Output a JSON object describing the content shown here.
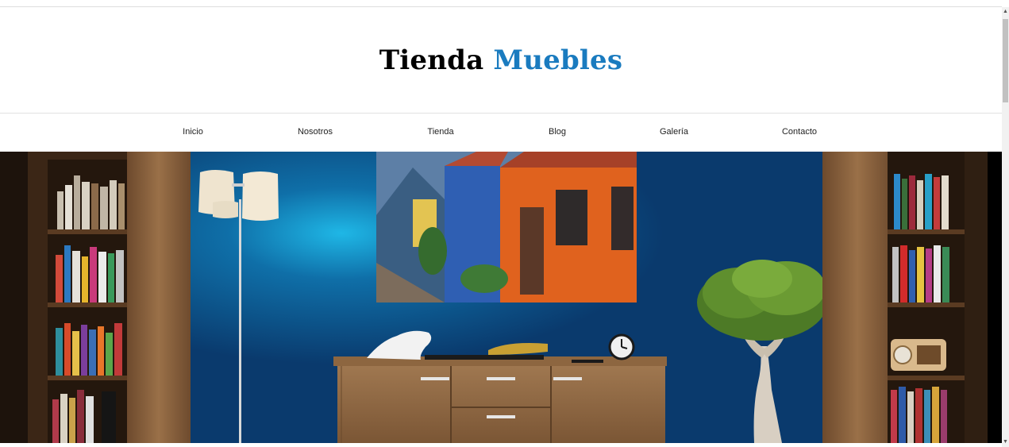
{
  "header": {
    "title_part1": "Tienda",
    "title_part2": "Muebles",
    "accent_color": "#1a7bbf"
  },
  "nav": {
    "items": [
      {
        "label": "Inicio"
      },
      {
        "label": "Nosotros"
      },
      {
        "label": "Tienda"
      },
      {
        "label": "Blog"
      },
      {
        "label": "Galería"
      },
      {
        "label": "Contacto"
      }
    ]
  },
  "hero": {
    "image": "living-room-furniture-photo",
    "wall_color": "#0c3f73"
  },
  "scrollbar": {
    "up_icon": "triangle-up-icon",
    "down_icon": "triangle-down-icon"
  }
}
